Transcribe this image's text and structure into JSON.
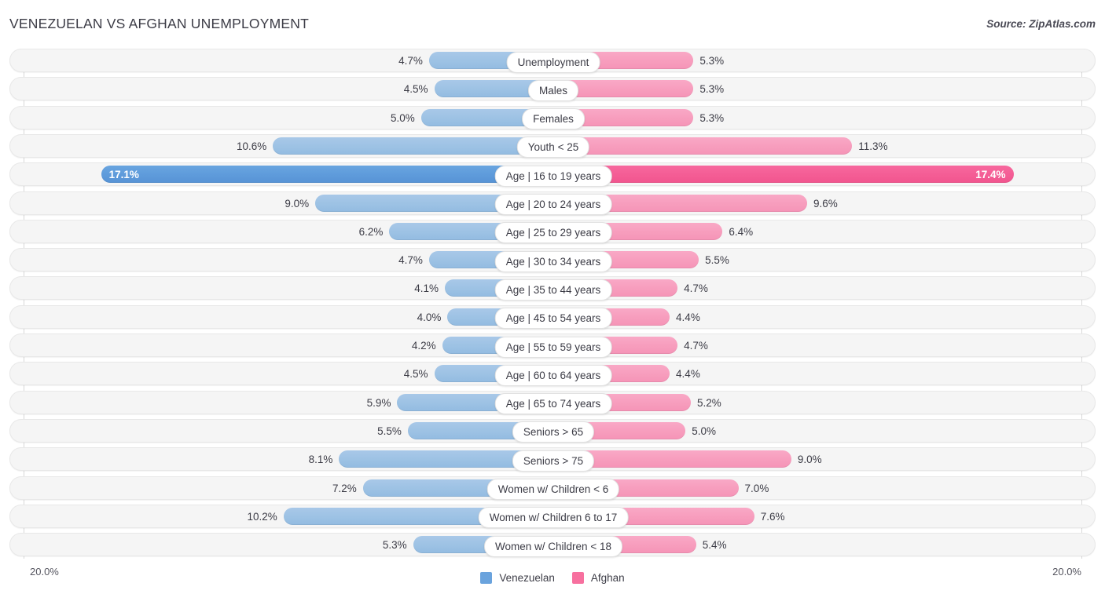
{
  "header": {
    "title": "VENEZUELAN VS AFGHAN UNEMPLOYMENT",
    "source": "Source: ZipAtlas.com"
  },
  "axis": {
    "left_label": "20.0%",
    "right_label": "20.0%",
    "max": 20.0
  },
  "legend": {
    "items": [
      {
        "label": "Venezuelan",
        "color": "#6aa3dd"
      },
      {
        "label": "Afghan",
        "color": "#f7709f"
      }
    ]
  },
  "colors": {
    "left_bar": "#9dc2e4",
    "right_bar": "#f79dbd",
    "left_bar_peak": "#5e9bdb",
    "right_bar_peak": "#f45d95",
    "track": "#f5f5f5"
  },
  "chart_data": {
    "type": "bar",
    "title": "VENEZUELAN VS AFGHAN UNEMPLOYMENT",
    "subtitle": "Source: ZipAtlas.com",
    "orientation": "horizontal-diverging",
    "xlabel": "",
    "ylabel": "",
    "xlim": [
      20.0,
      20.0
    ],
    "grid": false,
    "legend_position": "bottom-center",
    "categories": [
      "Unemployment",
      "Males",
      "Females",
      "Youth < 25",
      "Age | 16 to 19 years",
      "Age | 20 to 24 years",
      "Age | 25 to 29 years",
      "Age | 30 to 34 years",
      "Age | 35 to 44 years",
      "Age | 45 to 54 years",
      "Age | 55 to 59 years",
      "Age | 60 to 64 years",
      "Age | 65 to 74 years",
      "Seniors > 65",
      "Seniors > 75",
      "Women w/ Children < 6",
      "Women w/ Children 6 to 17",
      "Women w/ Children < 18"
    ],
    "series": [
      {
        "name": "Venezuelan",
        "color": "#6aa3dd",
        "side": "left",
        "values": [
          4.7,
          4.5,
          5.0,
          10.6,
          17.1,
          9.0,
          6.2,
          4.7,
          4.1,
          4.0,
          4.2,
          4.5,
          5.9,
          5.5,
          8.1,
          7.2,
          10.2,
          5.3
        ]
      },
      {
        "name": "Afghan",
        "color": "#f7709f",
        "side": "right",
        "values": [
          5.3,
          5.3,
          5.3,
          11.3,
          17.4,
          9.6,
          6.4,
          5.5,
          4.7,
          4.4,
          4.7,
          4.4,
          5.2,
          5.0,
          9.0,
          7.0,
          7.6,
          5.4
        ]
      }
    ]
  },
  "rows": [
    {
      "label": "Unemployment",
      "left": "4.7%",
      "right": "5.3%",
      "lv": 4.7,
      "rv": 5.3,
      "peak": false
    },
    {
      "label": "Males",
      "left": "4.5%",
      "right": "5.3%",
      "lv": 4.5,
      "rv": 5.3,
      "peak": false
    },
    {
      "label": "Females",
      "left": "5.0%",
      "right": "5.3%",
      "lv": 5.0,
      "rv": 5.3,
      "peak": false
    },
    {
      "label": "Youth < 25",
      "left": "10.6%",
      "right": "11.3%",
      "lv": 10.6,
      "rv": 11.3,
      "peak": false
    },
    {
      "label": "Age | 16 to 19 years",
      "left": "17.1%",
      "right": "17.4%",
      "lv": 17.1,
      "rv": 17.4,
      "peak": true
    },
    {
      "label": "Age | 20 to 24 years",
      "left": "9.0%",
      "right": "9.6%",
      "lv": 9.0,
      "rv": 9.6,
      "peak": false
    },
    {
      "label": "Age | 25 to 29 years",
      "left": "6.2%",
      "right": "6.4%",
      "lv": 6.2,
      "rv": 6.4,
      "peak": false
    },
    {
      "label": "Age | 30 to 34 years",
      "left": "4.7%",
      "right": "5.5%",
      "lv": 4.7,
      "rv": 5.5,
      "peak": false
    },
    {
      "label": "Age | 35 to 44 years",
      "left": "4.1%",
      "right": "4.7%",
      "lv": 4.1,
      "rv": 4.7,
      "peak": false
    },
    {
      "label": "Age | 45 to 54 years",
      "left": "4.0%",
      "right": "4.4%",
      "lv": 4.0,
      "rv": 4.4,
      "peak": false
    },
    {
      "label": "Age | 55 to 59 years",
      "left": "4.2%",
      "right": "4.7%",
      "lv": 4.2,
      "rv": 4.7,
      "peak": false
    },
    {
      "label": "Age | 60 to 64 years",
      "left": "4.5%",
      "right": "4.4%",
      "lv": 4.5,
      "rv": 4.4,
      "peak": false
    },
    {
      "label": "Age | 65 to 74 years",
      "left": "5.9%",
      "right": "5.2%",
      "lv": 5.9,
      "rv": 5.2,
      "peak": false
    },
    {
      "label": "Seniors > 65",
      "left": "5.5%",
      "right": "5.0%",
      "lv": 5.5,
      "rv": 5.0,
      "peak": false
    },
    {
      "label": "Seniors > 75",
      "left": "8.1%",
      "right": "9.0%",
      "lv": 8.1,
      "rv": 9.0,
      "peak": false
    },
    {
      "label": "Women w/ Children < 6",
      "left": "7.2%",
      "right": "7.0%",
      "lv": 7.2,
      "rv": 7.0,
      "peak": false
    },
    {
      "label": "Women w/ Children 6 to 17",
      "left": "10.2%",
      "right": "7.6%",
      "lv": 10.2,
      "rv": 7.6,
      "peak": false
    },
    {
      "label": "Women w/ Children < 18",
      "left": "5.3%",
      "right": "5.4%",
      "lv": 5.3,
      "rv": 5.4,
      "peak": false
    }
  ]
}
